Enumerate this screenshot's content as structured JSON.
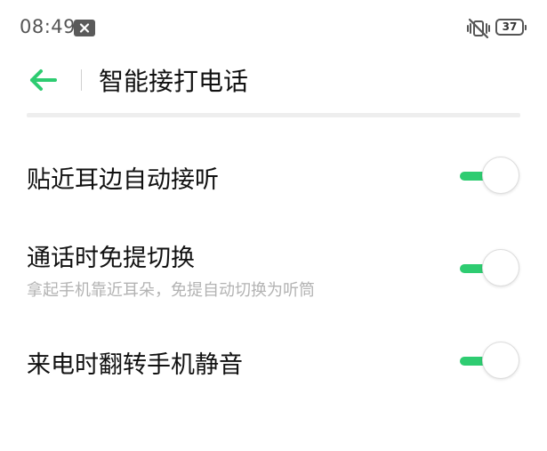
{
  "status_bar": {
    "time": "08:49",
    "battery": "37",
    "icons": [
      "notification-x-icon",
      "vibrate-muted-icon",
      "battery-icon"
    ]
  },
  "header": {
    "back_icon": "arrow-left-icon",
    "title": "智能接打电话"
  },
  "settings": [
    {
      "label": "贴近耳边自动接听",
      "description": "",
      "enabled": true
    },
    {
      "label": "通话时免提切换",
      "description": "拿起手机靠近耳朵，免提自动切换为听筒",
      "enabled": true
    },
    {
      "label": "来电时翻转手机静音",
      "description": "",
      "enabled": true
    }
  ],
  "colors": {
    "accent": "#2ecc71",
    "text": "#111111",
    "secondary_text": "#b3b3b3",
    "status_text": "#555555"
  }
}
